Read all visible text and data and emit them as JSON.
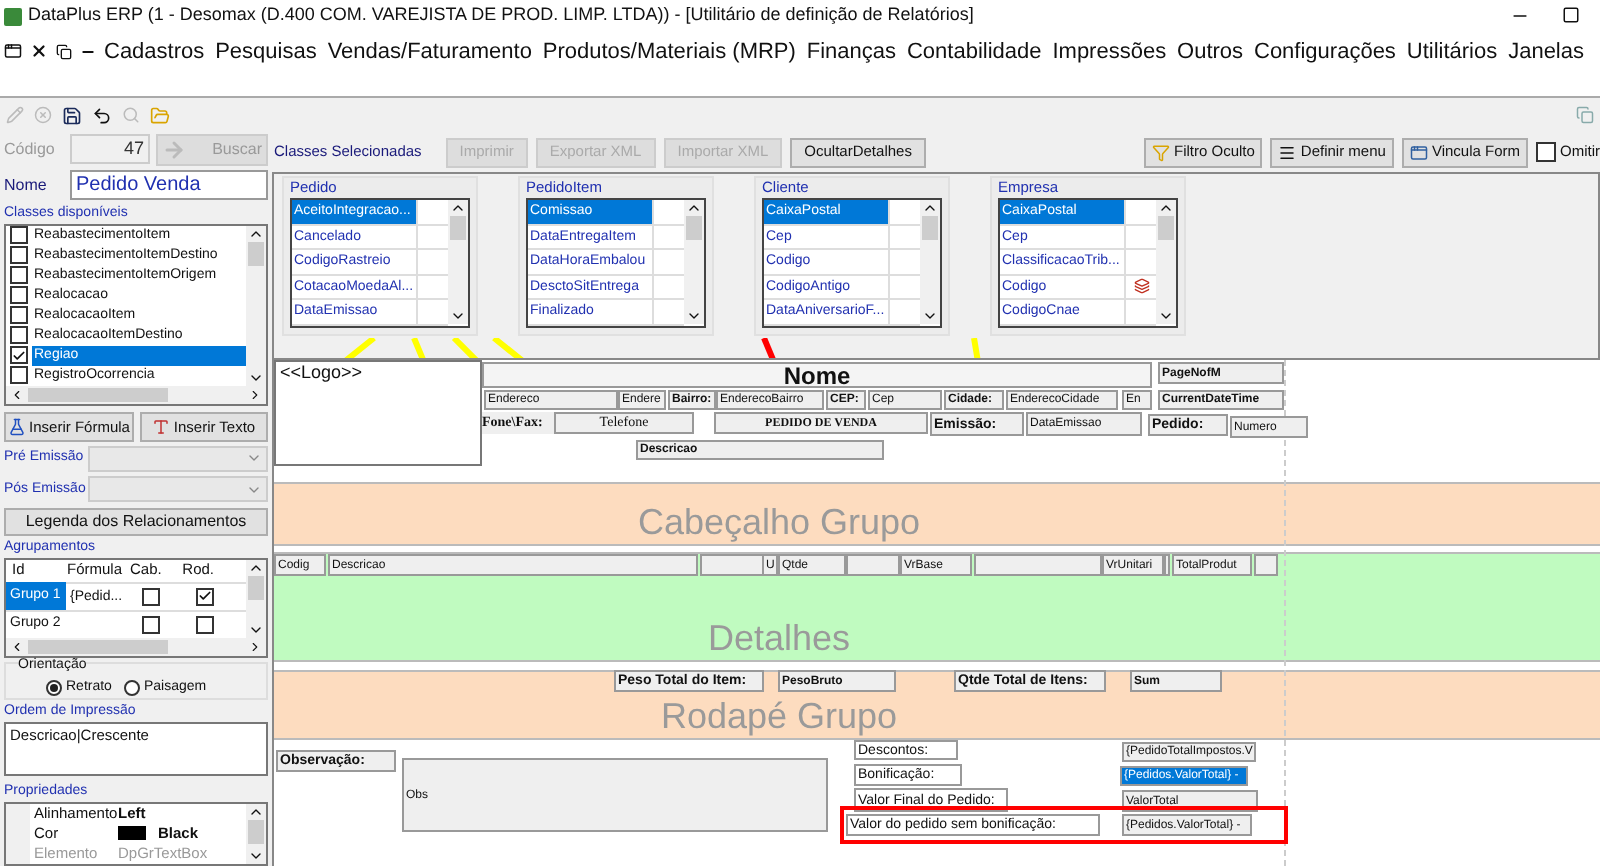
{
  "window": {
    "title": "DataPlus ERP (1 - Desomax   (D.400 COM. VAREJISTA DE PROD. LIMP. LTDA)) - [Utilitário de definição de Relatórios]"
  },
  "menu": [
    "Cadastros",
    "Pesquisas",
    "Vendas/Faturamento",
    "Produtos/Materiais (MRP)",
    "Finanças",
    "Contabilidade",
    "Impressões",
    "Outros",
    "Configurações",
    "Utilitários",
    "Janelas"
  ],
  "codigo": {
    "label": "Código",
    "value": "47",
    "button": "Buscar"
  },
  "nome": {
    "label": "Nome",
    "value": "Pedido Venda"
  },
  "classes_label": "Classes Selecionadas",
  "actions": [
    {
      "label": "Imprimir",
      "disabled": true
    },
    {
      "label": "Exportar XML",
      "disabled": true
    },
    {
      "label": "Importar XML",
      "disabled": true
    },
    {
      "label": "OcultarDetalhes",
      "disabled": false
    }
  ],
  "right_actions": [
    {
      "label": "Filtro Oculto",
      "kind": "filter"
    },
    {
      "label": "Definir menu",
      "kind": "menu"
    },
    {
      "label": "Vincula Form",
      "kind": "form"
    }
  ],
  "omit": {
    "label": "Omitir",
    "checked": false
  },
  "available_classes": {
    "label": "Classes disponíveis",
    "items": [
      {
        "name": "ReabastecimentoItem",
        "checked": false,
        "selected": false
      },
      {
        "name": "ReabastecimentoItemDestino",
        "checked": false,
        "selected": false
      },
      {
        "name": "ReabastecimentoItemOrigem",
        "checked": false,
        "selected": false
      },
      {
        "name": "Realocacao",
        "checked": false,
        "selected": false
      },
      {
        "name": "RealocacaoItem",
        "checked": false,
        "selected": false
      },
      {
        "name": "RealocacaoItemDestino",
        "checked": false,
        "selected": false
      },
      {
        "name": "Regiao",
        "checked": true,
        "selected": true
      },
      {
        "name": "RegistroOcorrencia",
        "checked": false,
        "selected": false
      }
    ]
  },
  "insert_buttons": [
    {
      "label": "Inserir Fórmula",
      "kind": "formula"
    },
    {
      "label": "Inserir Texto",
      "kind": "text"
    }
  ],
  "emission": [
    {
      "label": "Pré Emissão"
    },
    {
      "label": "Pós Emissão"
    }
  ],
  "legend_button": "Legenda dos Relacionamentos",
  "groupings": {
    "label": "Agrupamentos",
    "columns": [
      "Id",
      "Fórmula",
      "Cab.",
      "Rod."
    ],
    "rows": [
      {
        "id": "Grupo 1",
        "formula": "{Pedid...",
        "header": false,
        "footer": true,
        "selected": true
      },
      {
        "id": "Grupo 2",
        "header": false,
        "footer": false,
        "selected": false
      }
    ]
  },
  "orientation": {
    "label": "Orientação",
    "options": [
      {
        "label": "Retrato",
        "selected": true
      },
      {
        "label": "Paisagem",
        "selected": false
      }
    ]
  },
  "print_order": {
    "label": "Ordem de Impressão",
    "value": "Descricao|Crescente"
  },
  "properties": {
    "label": "Propriedades",
    "rows": [
      {
        "name": "Alinhamento",
        "value": "Left",
        "kind": "text",
        "disabled": false
      },
      {
        "name": "Cor",
        "value": "Black",
        "kind": "color",
        "color": "#000000",
        "disabled": false
      },
      {
        "name": "Elemento",
        "value": "DpGrTextBox",
        "kind": "text",
        "disabled": true
      }
    ]
  },
  "class_tables": [
    {
      "title": "Pedido",
      "fields": [
        {
          "name": "AceitoIntegracao...",
          "selected": true,
          "icon": false
        },
        {
          "name": "Cancelado",
          "selected": false,
          "icon": false
        },
        {
          "name": "CodigoRastreio",
          "selected": false,
          "icon": false
        },
        {
          "name": "CotacaoMoedaAl...",
          "selected": false,
          "icon": false
        },
        {
          "name": "DataEmissao",
          "selected": false,
          "icon": false
        }
      ]
    },
    {
      "title": "PedidoItem",
      "fields": [
        {
          "name": "Comissao",
          "selected": true,
          "icon": false
        },
        {
          "name": "DataEntregaItem",
          "selected": false,
          "icon": false
        },
        {
          "name": "DataHoraEmbalou",
          "selected": false,
          "icon": false
        },
        {
          "name": "DesctoSitEntrega",
          "selected": false,
          "icon": false
        },
        {
          "name": "Finalizado",
          "selected": false,
          "icon": false
        }
      ]
    },
    {
      "title": "Cliente",
      "fields": [
        {
          "name": "CaixaPostal",
          "selected": true,
          "icon": false
        },
        {
          "name": "Cep",
          "selected": false,
          "icon": false
        },
        {
          "name": "Codigo",
          "selected": false,
          "icon": false
        },
        {
          "name": "CodigoAntigo",
          "selected": false,
          "icon": false
        },
        {
          "name": "DataAniversarioF...",
          "selected": false,
          "icon": false
        }
      ]
    },
    {
      "title": "Empresa",
      "fields": [
        {
          "name": "CaixaPostal",
          "selected": true,
          "icon": false
        },
        {
          "name": "Cep",
          "selected": false,
          "icon": false
        },
        {
          "name": "ClassificacaoTrib...",
          "selected": false,
          "icon": false
        },
        {
          "name": "Codigo",
          "selected": false,
          "icon": true
        },
        {
          "name": "CodigoCnae",
          "selected": false,
          "icon": false
        }
      ]
    }
  ],
  "report": {
    "header": [
      {
        "text": "<<Logo>>",
        "kind": "logo"
      },
      {
        "text": "Nome",
        "kind": "title"
      },
      {
        "text": "PageNofM",
        "kind": "field_bold"
      },
      {
        "text": "Endereco",
        "kind": "field"
      },
      {
        "text": "Endere",
        "kind": "field"
      },
      {
        "text": "Bairro:",
        "kind": "label"
      },
      {
        "text": "EnderecoBairro",
        "kind": "field"
      },
      {
        "text": "CEP:",
        "kind": "label"
      },
      {
        "text": "Cep",
        "kind": "field"
      },
      {
        "text": "Cidade:",
        "kind": "label"
      },
      {
        "text": "EnderecoCidade",
        "kind": "field"
      },
      {
        "text": "En",
        "kind": "field"
      },
      {
        "text": "CurrentDateTime",
        "kind": "field_bold"
      },
      {
        "text": "Fone\\Fax:",
        "kind": "serif_label"
      },
      {
        "text": "Telefone",
        "kind": "serif_field"
      },
      {
        "text": "PEDIDO DE VENDA",
        "kind": "serif_title"
      },
      {
        "text": "Emissão:",
        "kind": "label_big"
      },
      {
        "text": "DataEmissao",
        "kind": "field"
      },
      {
        "text": "Pedido:",
        "kind": "label_big"
      },
      {
        "text": "Numero",
        "kind": "field"
      },
      {
        "text": "Descricao",
        "kind": "label"
      }
    ],
    "bands": [
      {
        "title": "Cabeçalho Grupo",
        "kind": "group"
      },
      {
        "title": "Detalhes",
        "kind": "detail"
      },
      {
        "title": "Rodapé Grupo",
        "kind": "group"
      }
    ],
    "detail_fields": [
      "Codig",
      "Descricao",
      "U",
      "Qtde",
      "VrBase",
      "VrUnitari",
      "TotalProdut"
    ],
    "group_footer": [
      {
        "text": "Peso Total do Item:",
        "kind": "label_big"
      },
      {
        "text": "PesoBruto",
        "kind": "field_bold"
      },
      {
        "text": "Qtde Total de Itens:",
        "kind": "label_big"
      },
      {
        "text": "Sum",
        "kind": "field_bold"
      }
    ],
    "footer": [
      {
        "text": "Observação:",
        "kind": "label_big",
        "selected": false
      },
      {
        "text": "Obs",
        "kind": "field",
        "selected": false
      },
      {
        "text": "Descontos:",
        "kind": "caption",
        "selected": false
      },
      {
        "text": "{PedidoTotalImpostos.V",
        "kind": "field",
        "selected": false
      },
      {
        "text": "Bonificação:",
        "kind": "caption",
        "selected": false
      },
      {
        "text": "{Pedidos.ValorTotal} -",
        "kind": "field",
        "selected": true
      },
      {
        "text": "Valor Final do Pedido:",
        "kind": "caption",
        "selected": false
      },
      {
        "text": "ValorTotal",
        "kind": "field",
        "selected": false
      },
      {
        "text": "Valor do pedido sem bonificação:",
        "kind": "caption",
        "selected": false
      },
      {
        "text": "{Pedidos.ValorTotal} -",
        "kind": "field",
        "selected": false
      }
    ]
  }
}
